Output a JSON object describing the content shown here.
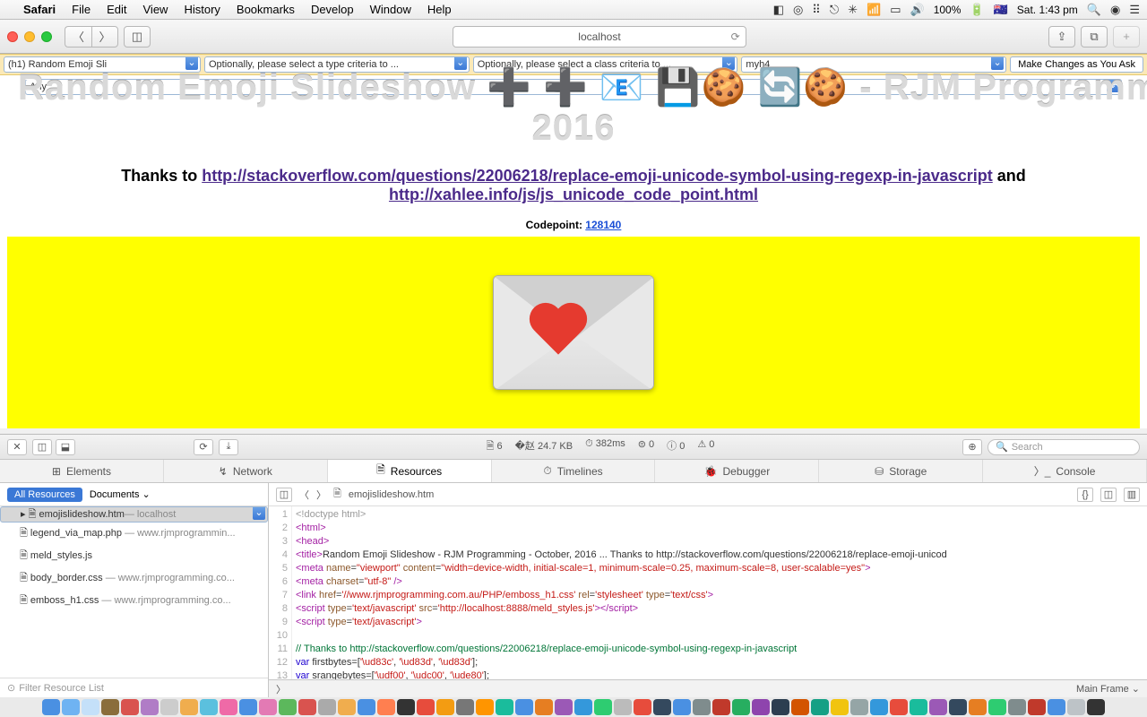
{
  "menubar": {
    "apple": "",
    "app": "Safari",
    "items": [
      "File",
      "Edit",
      "View",
      "History",
      "Bookmarks",
      "Develop",
      "Window",
      "Help"
    ],
    "battery": "100%",
    "clock": "Sat. 1:43 pm"
  },
  "toolbar": {
    "address": "localhost"
  },
  "selectors": {
    "s1": "(h1) Random Emoji Sli",
    "s2": "Optionally, please select a type criteria to ...",
    "s3": "Optionally, please select a class criteria to ...",
    "s4": "myh4",
    "ask": "Make Changes as You Ask",
    "any": "Any"
  },
  "page": {
    "title_line": "Random Emoji Slideshow ➕ ➕ 📧 💾🍪 🔄🍪 - RJM Programming - October,",
    "title_year": "2016",
    "thanks_pre": "Thanks to ",
    "thanks_link1": "http://stackoverflow.com/questions/22006218/replace-emoji-unicode-symbol-using-regexp-in-javascript",
    "thanks_mid": " and ",
    "thanks_link2": "http://xahlee.info/js/js_unicode_code_point.html",
    "codepoint_label": "Codepoint: ",
    "codepoint_value": "128140"
  },
  "devtools": {
    "stats": {
      "files": "6",
      "size": "24.7 KB",
      "time": "382ms",
      "e0": "0",
      "w0": "0",
      "a0": "0"
    },
    "search_ph": "Search",
    "tabs": [
      "Elements",
      "Network",
      "Resources",
      "Timelines",
      "Debugger",
      "Storage",
      "Console"
    ],
    "active_tab": "Resources",
    "side": {
      "pill": "All Resources",
      "scope": "Documents ⌄",
      "files": [
        {
          "name": "emojislideshow.htm",
          "host": "localhost"
        },
        {
          "name": "legend_via_map.php",
          "host": "www.rjmprogrammin..."
        },
        {
          "name": "meld_styles.js",
          "host": ""
        },
        {
          "name": "body_border.css",
          "host": "www.rjmprogramming.co..."
        },
        {
          "name": "emboss_h1.css",
          "host": "www.rjmprogramming.co..."
        }
      ],
      "filter_ph": "Filter Resource List"
    },
    "crumb_file": "emojislideshow.htm",
    "main_frame": "Main Frame ⌄",
    "code_lines": [
      {
        "n": 1,
        "h": "<span class='c-gray'>&lt;!doctype html&gt;</span>"
      },
      {
        "n": 2,
        "h": "<span class='c-purple'>&lt;html&gt;</span>"
      },
      {
        "n": 3,
        "h": "<span class='c-purple'>&lt;head&gt;</span>"
      },
      {
        "n": 4,
        "h": "<span class='c-purple'>&lt;title&gt;</span>Random Emoji Slideshow - RJM Programming - October, 2016 ... Thanks to http://stackoverflow.com/questions/22006218/replace-emoji-unicod"
      },
      {
        "n": 5,
        "h": "<span class='c-purple'>&lt;meta</span> <span class='c-brown'>name</span>=<span class='c-red'>\"viewport\"</span> <span class='c-brown'>content</span>=<span class='c-red'>\"width=device-width, initial-scale=1, minimum-scale=0.25, maximum-scale=8, user-scalable=yes\"</span><span class='c-purple'>&gt;</span>"
      },
      {
        "n": 6,
        "h": "<span class='c-purple'>&lt;meta</span> <span class='c-brown'>charset</span>=<span class='c-red'>\"utf-8\"</span> <span class='c-purple'>/&gt;</span>"
      },
      {
        "n": 7,
        "h": "<span class='c-purple'>&lt;link</span> <span class='c-brown'>href</span>=<span class='c-red'>'//www.rjmprogramming.com.au/PHP/emboss_h1.css'</span> <span class='c-brown'>rel</span>=<span class='c-red'>'stylesheet'</span> <span class='c-brown'>type</span>=<span class='c-red'>'text/css'</span><span class='c-purple'>&gt;</span>"
      },
      {
        "n": 8,
        "h": "<span class='c-purple'>&lt;script</span> <span class='c-brown'>type</span>=<span class='c-red'>'text/javascript'</span> <span class='c-brown'>src</span>=<span class='c-red'>'http://localhost:8888/meld_styles.js'</span><span class='c-purple'>&gt;&lt;/script&gt;</span>"
      },
      {
        "n": 9,
        "h": "<span class='c-purple'>&lt;script</span> <span class='c-brown'>type</span>=<span class='c-red'>'text/javascript'</span><span class='c-purple'>&gt;</span>"
      },
      {
        "n": 10,
        "h": ""
      },
      {
        "n": 11,
        "h": "<span class='c-green'>// Thanks to http://stackoverflow.com/questions/22006218/replace-emoji-unicode-symbol-using-regexp-in-javascript</span>"
      },
      {
        "n": 12,
        "h": "<span class='c-blue'>var</span> firstbytes=[<span class='c-red'>'\\ud83c'</span>, <span class='c-red'>'\\ud83d'</span>, <span class='c-red'>'\\ud83d'</span>];"
      },
      {
        "n": 13,
        "h": "<span class='c-blue'>var</span> srangebytes=[<span class='c-red'>'\\udf00'</span>, <span class='c-red'>'\\udc00'</span>, <span class='c-red'>'\\ude80'</span>];"
      }
    ]
  },
  "dock_colors": [
    "#4a90e2",
    "#6fb3f2",
    "#c4e0f9",
    "#8a6d3b",
    "#d9534f",
    "#b07cc6",
    "#ccc",
    "#f0ad4e",
    "#5bc0de",
    "#ef6aa7",
    "#4a90e2",
    "#e37ab4",
    "#5cb85c",
    "#d9534f",
    "#aaa",
    "#f0ad4e",
    "#4a90e2",
    "#ff7f50",
    "#333",
    "#e74c3c",
    "#f39c12",
    "#777",
    "#ff9500",
    "#1abc9c",
    "#4a90e2",
    "#e67e22",
    "#9b59b6",
    "#3498db",
    "#2ecc71",
    "#bbb",
    "#e74c3c",
    "#34495e",
    "#4a90e2",
    "#7f8c8d",
    "#c0392b",
    "#27ae60",
    "#8e44ad",
    "#2c3e50",
    "#d35400",
    "#16a085",
    "#f1c40f",
    "#95a5a6",
    "#3498db",
    "#e74c3c",
    "#1abc9c",
    "#9b59b6",
    "#34495e",
    "#e67e22",
    "#2ecc71",
    "#7f8c8d",
    "#c0392b",
    "#4a90e2",
    "#bdc3c7",
    "#333"
  ]
}
